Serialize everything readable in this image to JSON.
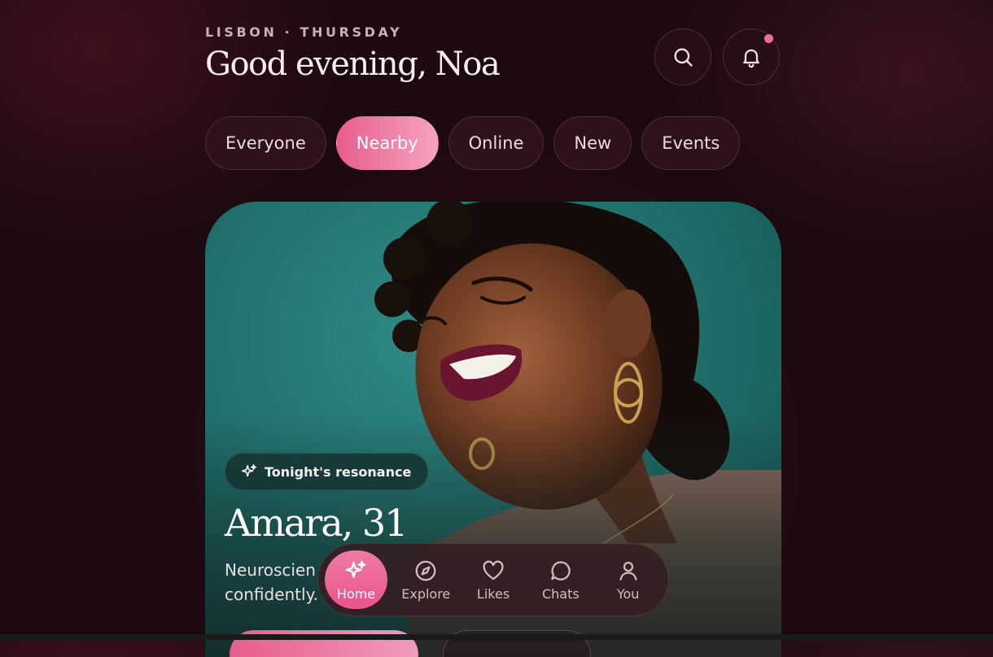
{
  "header": {
    "eyebrow": "LISBON · THURSDAY",
    "greeting": "Good evening, Noa",
    "search_icon": "search-icon",
    "notifications_icon": "bell-icon",
    "has_unread": true
  },
  "filters": [
    {
      "label": "Everyone",
      "active": false
    },
    {
      "label": "Nearby",
      "active": true
    },
    {
      "label": "Online",
      "active": false
    },
    {
      "label": "New",
      "active": false
    },
    {
      "label": "Events",
      "active": false
    }
  ],
  "profile_card": {
    "badge_icon": "sparkles-icon",
    "badge_label": "Tonight's resonance",
    "name_age": "Amara, 31",
    "bio": "Neuroscien",
    "bio_line2": "confidently."
  },
  "tabbar": [
    {
      "label": "Home",
      "icon": "sparkles-icon",
      "active": true
    },
    {
      "label": "Explore",
      "icon": "compass-icon",
      "active": false
    },
    {
      "label": "Likes",
      "icon": "heart-icon",
      "active": false
    },
    {
      "label": "Chats",
      "icon": "chat-bubble-icon",
      "active": false
    },
    {
      "label": "You",
      "icon": "user-icon",
      "active": false
    }
  ],
  "colors": {
    "background": "#1d0a10",
    "accent_pink": "#e85d8d",
    "accent_pink_light": "#f5a3c2",
    "card_teal": "#1f6c68"
  }
}
